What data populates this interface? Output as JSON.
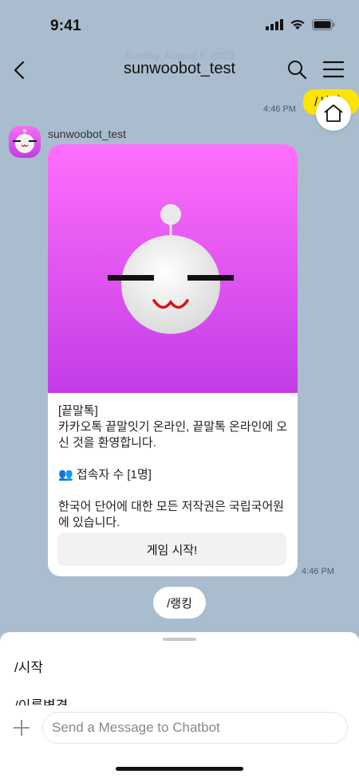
{
  "status": {
    "time": "9:41"
  },
  "nav": {
    "title": "sunwoobot_test",
    "subtitle": "Sunday, August 6, 2023"
  },
  "conversation": {
    "sent": {
      "text": "/시작",
      "time": "4:46 PM"
    },
    "bot": {
      "sender": "sunwoobot_test",
      "card": {
        "lines": [
          "[끝말톡]",
          "카카오톡 끝말잇기 온라인, 끝말톡 온라인에 오신 것을 환영합니다.",
          "",
          "👥 접속자 수 [1명]",
          "",
          "한국어 단어에 대한 모든 저작권은 국립국어원에 있습니다."
        ],
        "button_label": "게임 시작!"
      },
      "time": "4:46 PM"
    },
    "quick_reply": "/랭킹"
  },
  "sheet": {
    "items": [
      "/시작",
      "/이름변경"
    ]
  },
  "composer": {
    "placeholder": "Send a Message to Chatbot"
  },
  "colors": {
    "background": "#a9bdce",
    "sent_bubble": "#fee500",
    "card_gradient_top": "#ff6ffc",
    "card_gradient_bottom": "#c33ce6",
    "smile": "#d3131a"
  },
  "icons": [
    "back-arrow-icon",
    "search-icon",
    "hamburger-menu-icon",
    "home-icon",
    "plus-icon",
    "signal-icon",
    "wifi-icon",
    "battery-icon"
  ]
}
